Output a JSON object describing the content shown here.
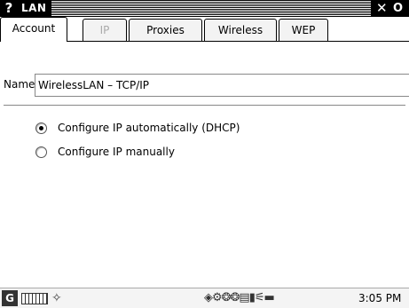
{
  "window": {
    "help_glyph": "?",
    "title": "LAN",
    "close_glyph": "✕",
    "ok_glyph": "O"
  },
  "tabs": [
    {
      "label": "Account",
      "active": true,
      "enabled": true
    },
    {
      "label": "IP",
      "active": false,
      "enabled": false
    },
    {
      "label": "Proxies",
      "active": false,
      "enabled": true
    },
    {
      "label": "Wireless",
      "active": false,
      "enabled": true
    },
    {
      "label": "WEP",
      "active": false,
      "enabled": true
    }
  ],
  "form": {
    "name_label": "Name:",
    "name_value": "WirelessLAN – TCP/IP"
  },
  "options": [
    {
      "label": "Configure IP automatically (DHCP)",
      "selected": true
    },
    {
      "label": "Configure IP manually",
      "selected": false
    }
  ],
  "taskbar": {
    "menu_glyph": "G",
    "keyboard_icon": "keyboard-icon",
    "network_glyph": "✧",
    "tray_glyphs": "◈⚙❂❂▤▮⚟▬",
    "clock": "3:05 PM"
  }
}
